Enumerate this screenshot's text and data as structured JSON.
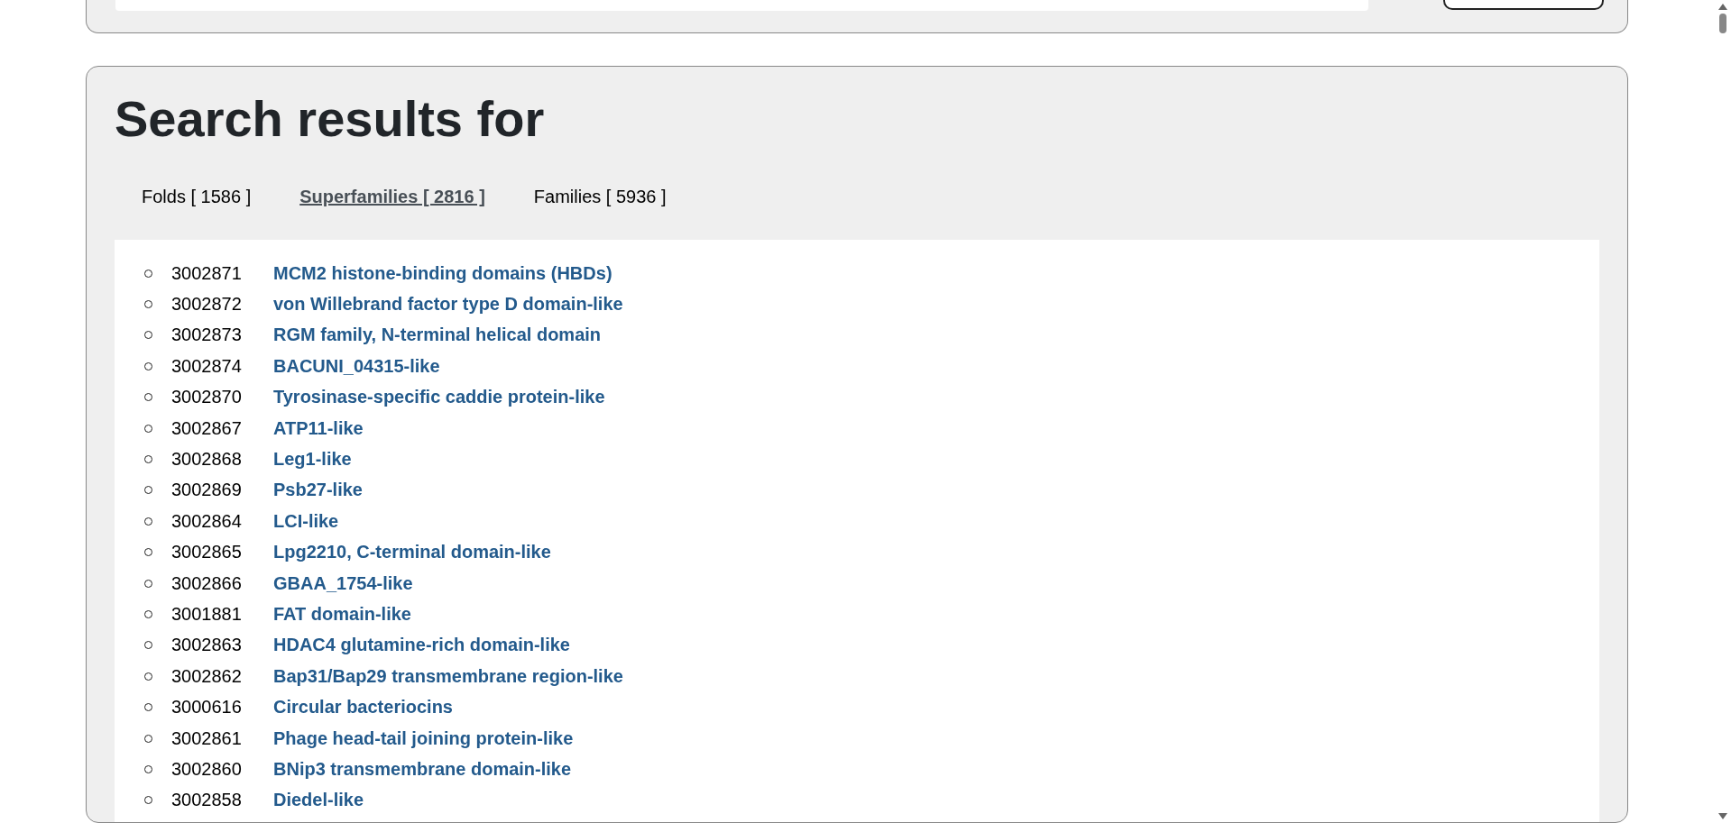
{
  "heading": "Search results for",
  "tabs": [
    {
      "label": "Folds [ 1586 ]",
      "selected": false
    },
    {
      "label": "Superfamilies [ 2816 ]",
      "selected": true
    },
    {
      "label": "Families [ 5936 ]",
      "selected": false
    }
  ],
  "results": [
    {
      "id": "3002871",
      "name": "MCM2 histone-binding domains (HBDs)"
    },
    {
      "id": "3002872",
      "name": "von Willebrand factor type D domain-like"
    },
    {
      "id": "3002873",
      "name": "RGM family, N-terminal helical domain"
    },
    {
      "id": "3002874",
      "name": "BACUNI_04315-like"
    },
    {
      "id": "3002870",
      "name": "Tyrosinase-specific caddie protein-like"
    },
    {
      "id": "3002867",
      "name": "ATP11-like"
    },
    {
      "id": "3002868",
      "name": "Leg1-like"
    },
    {
      "id": "3002869",
      "name": "Psb27-like"
    },
    {
      "id": "3002864",
      "name": "LCI-like"
    },
    {
      "id": "3002865",
      "name": "Lpg2210, C-terminal domain-like"
    },
    {
      "id": "3002866",
      "name": "GBAA_1754-like"
    },
    {
      "id": "3001881",
      "name": "FAT domain-like"
    },
    {
      "id": "3002863",
      "name": "HDAC4 glutamine-rich domain-like"
    },
    {
      "id": "3002862",
      "name": "Bap31/Bap29 transmembrane region-like"
    },
    {
      "id": "3000616",
      "name": "Circular bacteriocins"
    },
    {
      "id": "3002861",
      "name": "Phage head-tail joining protein-like"
    },
    {
      "id": "3002860",
      "name": "BNip3 transmembrane domain-like"
    },
    {
      "id": "3002858",
      "name": "Diedel-like"
    }
  ]
}
